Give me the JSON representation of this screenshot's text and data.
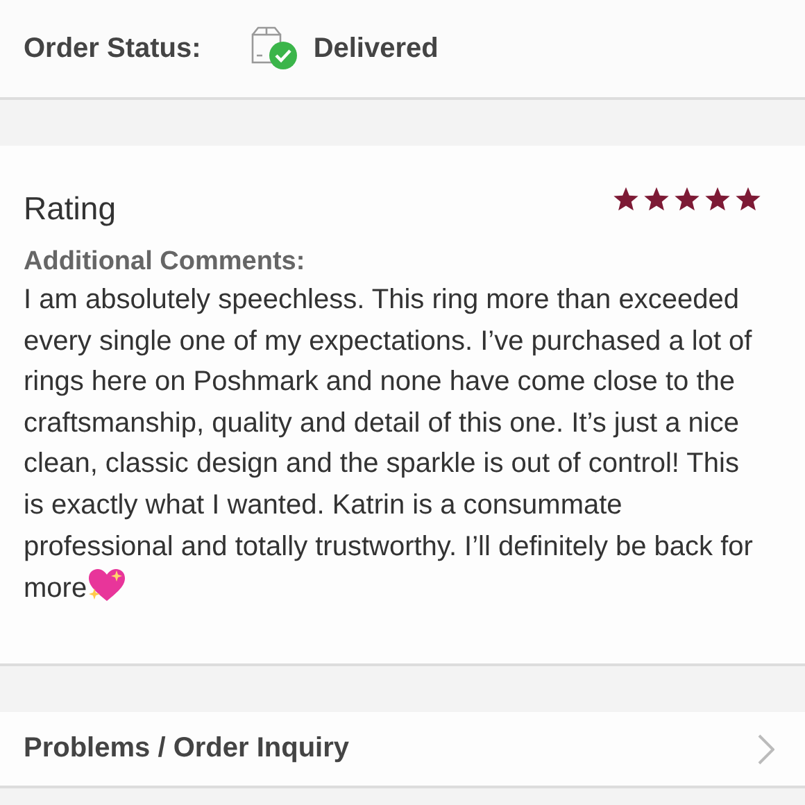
{
  "order_status": {
    "label": "Order Status:",
    "status": "Delivered",
    "delivered": true
  },
  "rating": {
    "title": "Rating",
    "stars": 5
  },
  "comments": {
    "label": "Additional Comments:",
    "text": "I am absolutely speechless. This ring more than exceeded every single one of my expectations. I’ve purchased a lot of rings here on Poshmark and none have come close to the craftsmanship, quality and detail of this one. It’s just a nice clean, classic design and the sparkle is out of control! This is exactly what I wanted. Katrin is a consummate professional and totally trustworthy. I’ll definitely be back for more"
  },
  "problems_link": {
    "label": "Problems / Order Inquiry"
  }
}
